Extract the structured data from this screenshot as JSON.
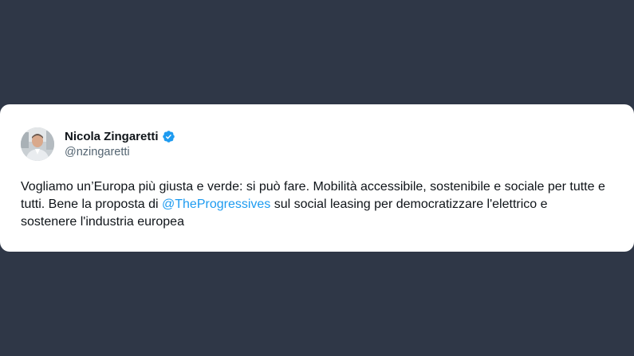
{
  "tweet": {
    "author": {
      "display_name": "Nicola Zingaretti",
      "handle": "@nzingaretti",
      "verified": true,
      "verified_icon": "verified-badge-icon",
      "avatar_icon": "profile-photo"
    },
    "text_before_mention": "Vogliamo un’Europa più giusta e verde: si può fare. Mobilità accessibile, sostenibile e sociale per tutte e tutti. Bene la proposta di ",
    "mention": "@TheProgressives",
    "text_after_mention": " sul social leasing per democratizzare l'elettrico e sostenere l'industria europea"
  },
  "colors": {
    "background": "#2f3747",
    "card": "#ffffff",
    "text": "#0f1419",
    "secondary_text": "#536471",
    "link": "#1d9bf0",
    "verified": "#1d9bf0"
  }
}
